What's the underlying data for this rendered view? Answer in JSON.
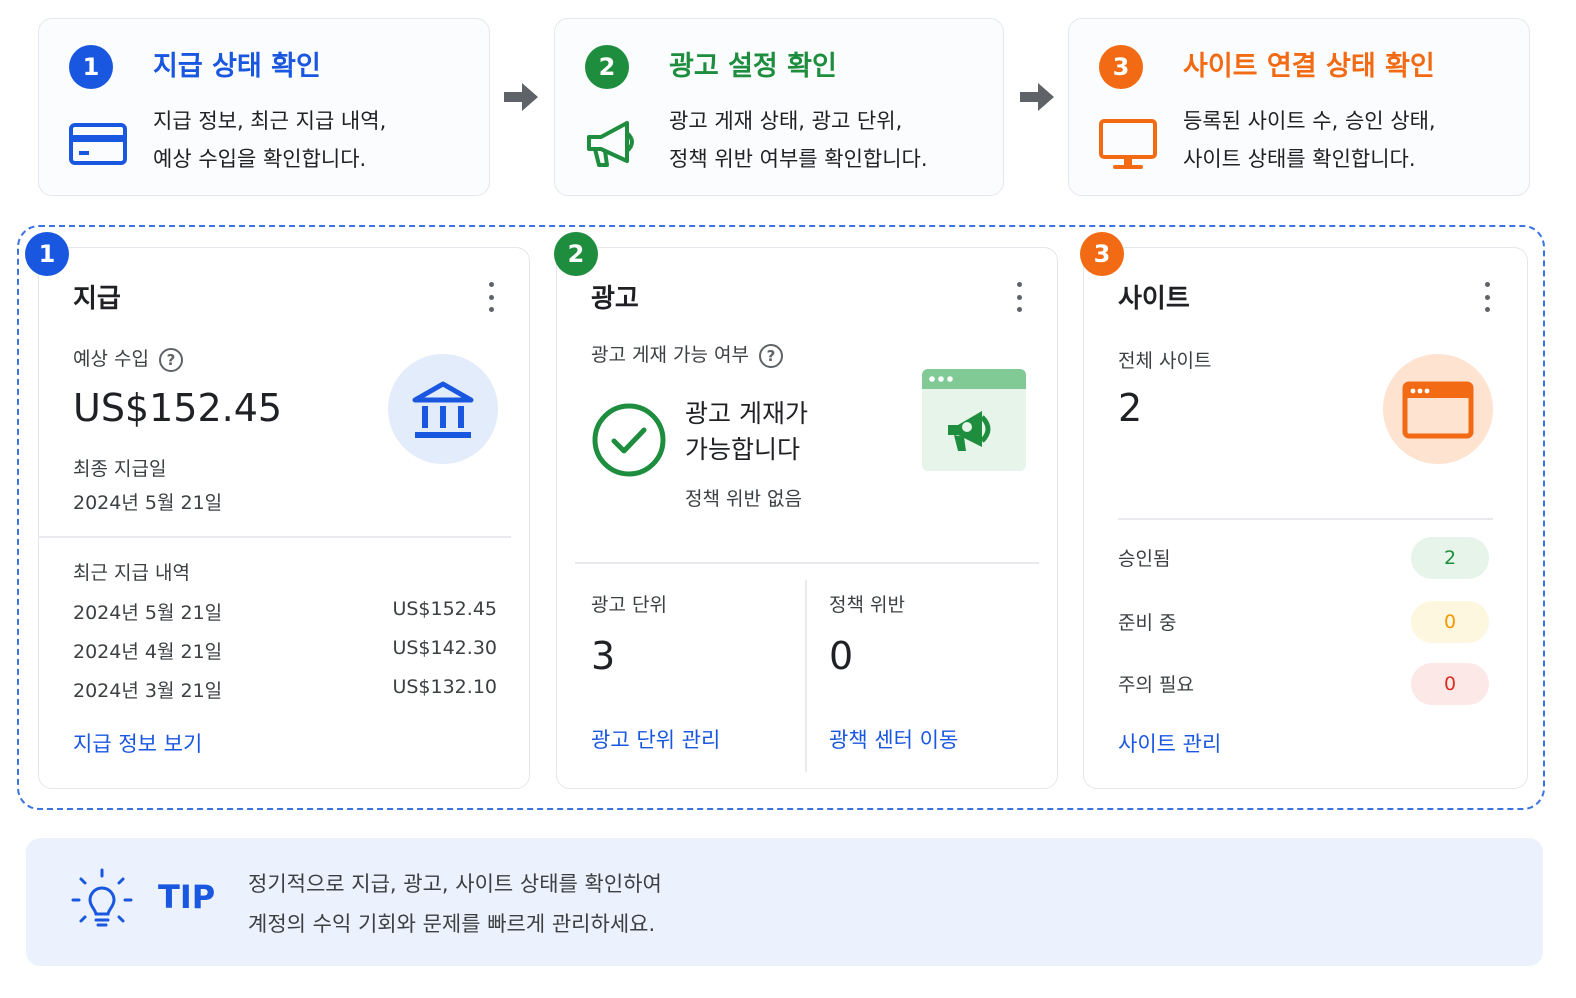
{
  "colors": {
    "blue": "#1a57e0",
    "green": "#1e8e3e",
    "orange": "#f26b14"
  },
  "steps": [
    {
      "num": "1",
      "title": "지급 상태 확인",
      "desc_line1": "지급 정보, 최근 지급 내역,",
      "desc_line2": "예상 수입을 확인합니다.",
      "icon": "credit-card-icon"
    },
    {
      "num": "2",
      "title": "광고 설정 확인",
      "desc_line1": "광고 게재 상태, 광고 단위,",
      "desc_line2": "정책 위반 여부를 확인합니다.",
      "icon": "megaphone-icon"
    },
    {
      "num": "3",
      "title": "사이트 연결 상태 확인",
      "desc_line1": "등록된 사이트 수, 승인 상태,",
      "desc_line2": "사이트 상태를 확인합니다.",
      "icon": "monitor-icon"
    }
  ],
  "payments": {
    "badge": "1",
    "title": "지급",
    "estimated_label": "예상 수입",
    "estimated_value": "US$152.45",
    "last_label": "최종 지급일",
    "last_date": "2024년 5월 21일",
    "history_label": "최근 지급 내역",
    "history": [
      {
        "date": "2024년 5월 21일",
        "amount": "US$152.45"
      },
      {
        "date": "2024년 4월 21일",
        "amount": "US$142.30"
      },
      {
        "date": "2024년 3월 21일",
        "amount": "US$132.10"
      }
    ],
    "link": "지급 정보 보기"
  },
  "ads": {
    "badge": "2",
    "title": "광고",
    "serving_label": "광고 게재 가능 여부",
    "status_line1": "광고 게재가",
    "status_line2": "가능합니다",
    "status_sub": "정책 위반 없음",
    "units_label": "광고 단위",
    "units_value": "3",
    "violations_label": "정책 위반",
    "violations_value": "0",
    "units_link": "광고 단위 관리",
    "policy_link": "광책 센터 이동"
  },
  "sites": {
    "badge": "3",
    "title": "사이트",
    "total_label": "전체 사이트",
    "total_value": "2",
    "statuses": [
      {
        "label": "승인됨",
        "value": "2",
        "bg": "#e6f4ea",
        "fg": "#1e8e3e"
      },
      {
        "label": "준비 중",
        "value": "0",
        "bg": "#fef7e0",
        "fg": "#f29900"
      },
      {
        "label": "주의 필요",
        "value": "0",
        "bg": "#fce8e6",
        "fg": "#d93025"
      }
    ],
    "link": "사이트 관리"
  },
  "tip": {
    "label": "TIP",
    "line1": "정기적으로 지급, 광고, 사이트 상태를 확인하여",
    "line2": "계정의 수익 기회와 문제를 빠르게 관리하세요."
  }
}
